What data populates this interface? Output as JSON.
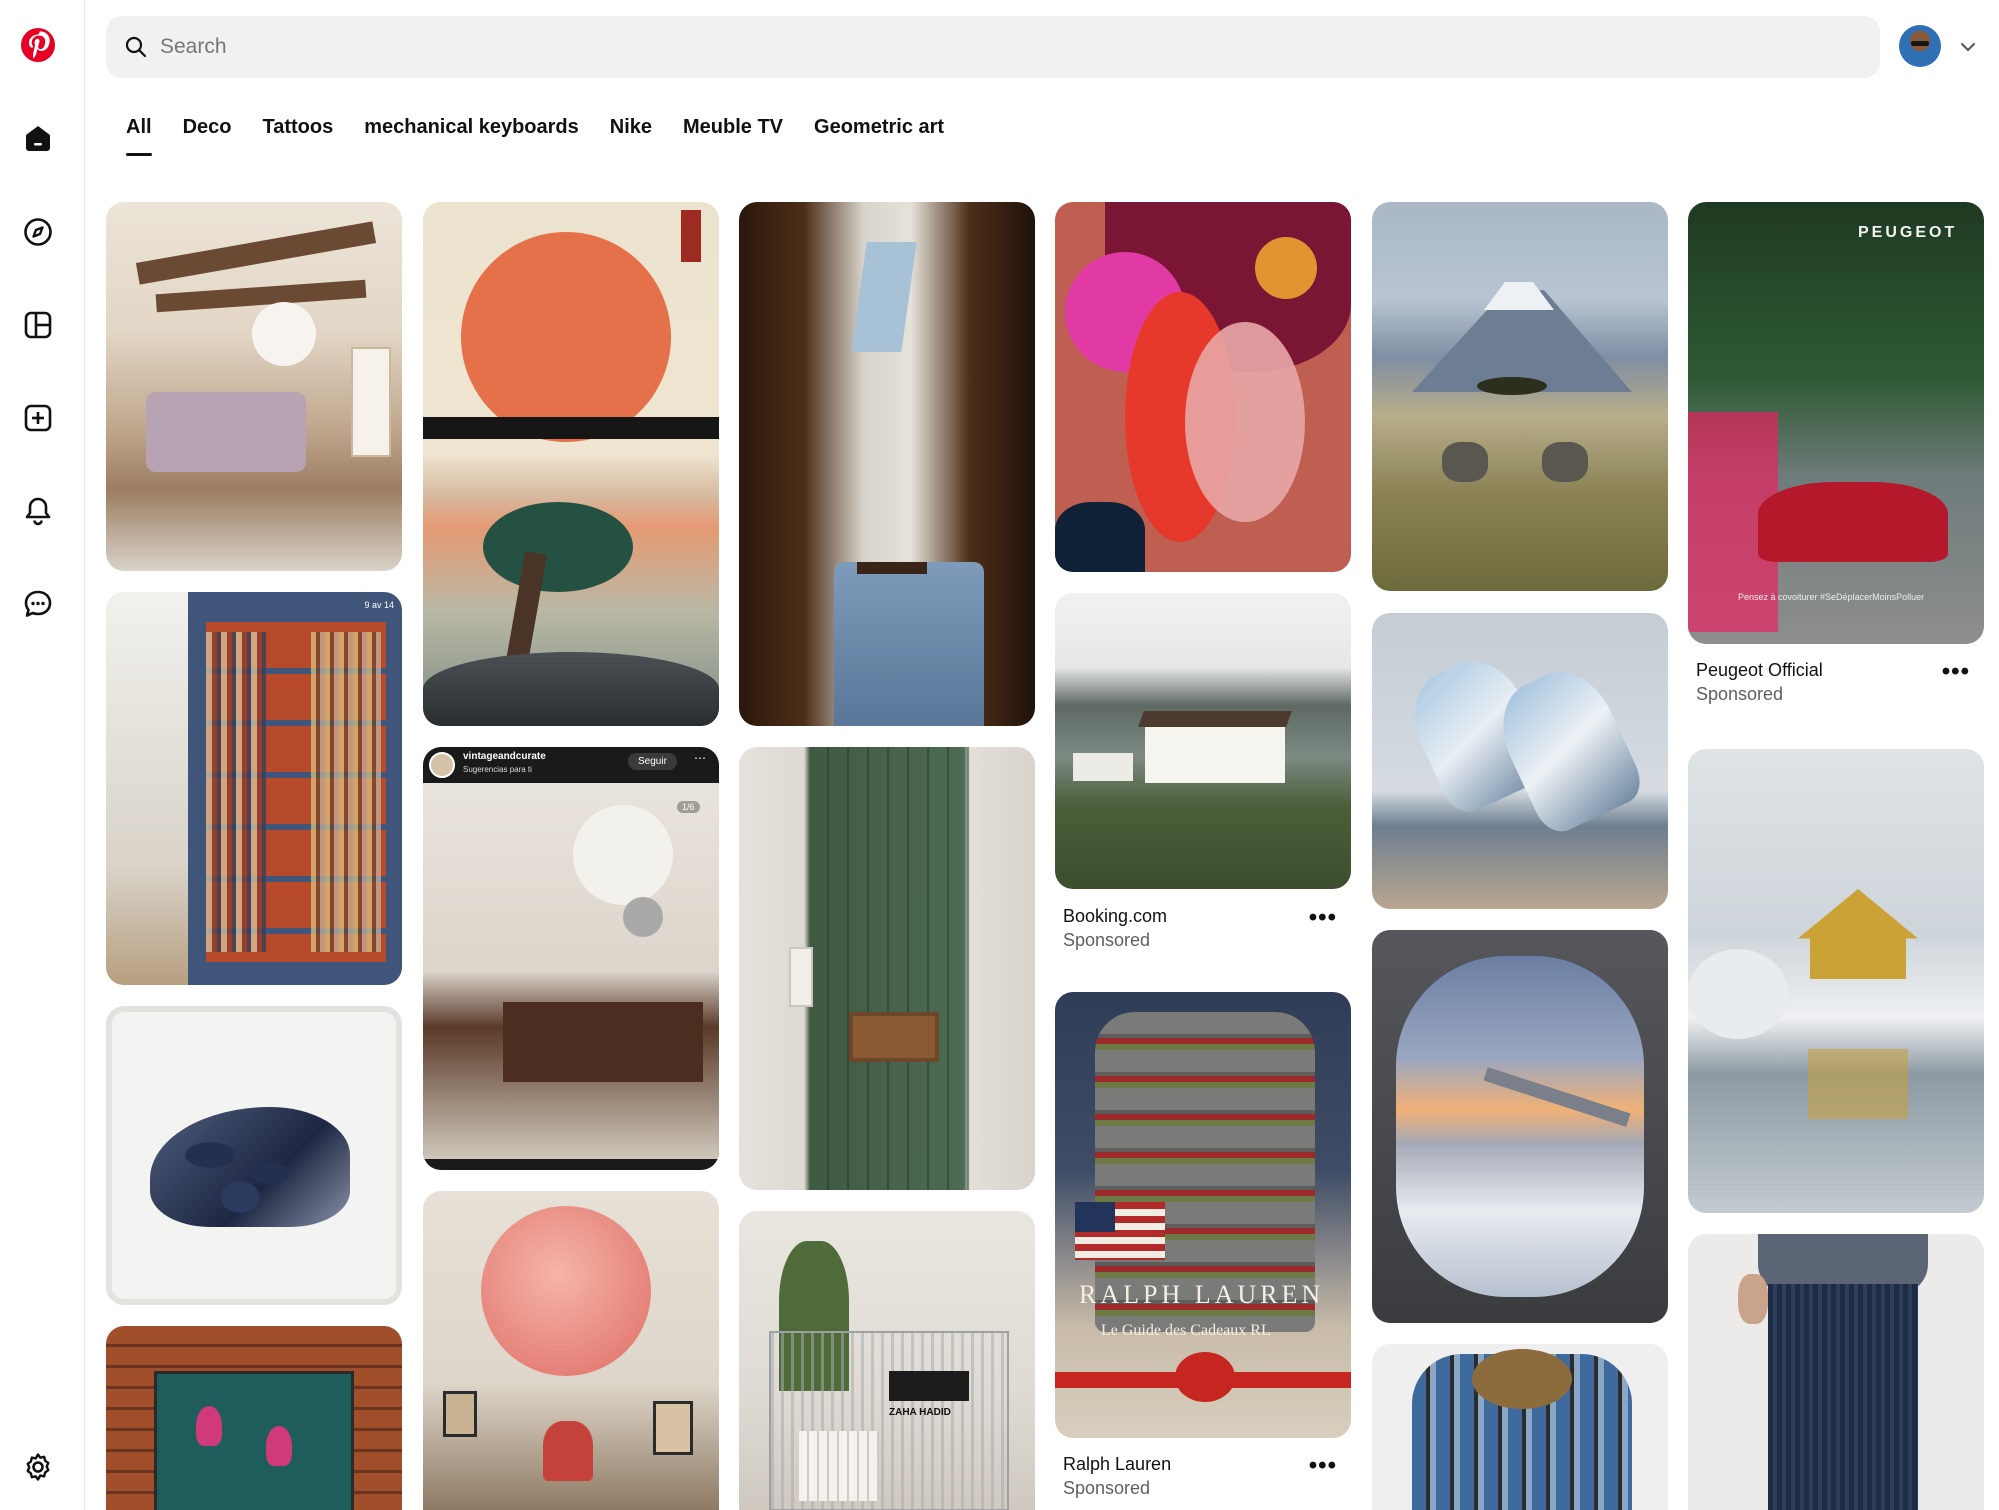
{
  "search": {
    "placeholder": "Search"
  },
  "tabs": [
    "All",
    "Deco",
    "Tattoos",
    "mechanical keyboards",
    "Nike",
    "Meuble TV",
    "Geometric art"
  ],
  "sidebar": {
    "items": [
      "pinterest-logo",
      "home-icon",
      "explore-icon",
      "boards-icon",
      "create-icon",
      "notifications-icon",
      "messages-icon",
      "settings-icon"
    ]
  },
  "pins": {
    "peugeot": {
      "brand_mark": "PEUGEOT",
      "fine_print": "Pensez à covoiturer #SeDéplacerMoinsPolluer",
      "title": "Peugeot Official",
      "subtitle": "Sponsored"
    },
    "booking": {
      "title": "Booking.com",
      "subtitle": "Sponsored"
    },
    "ralph": {
      "headline": "RALPH LAUREN",
      "tagline": "Le Guide des Cadeaux RL",
      "title": "Ralph Lauren",
      "subtitle": "Sponsored"
    },
    "vintage": {
      "account": "vintageandcurate",
      "sub": "Sugerencias para ti",
      "follow": "Seguir",
      "counter": "1/6"
    },
    "bookshelf_tag": "9 av 14",
    "book_label": "ZAHA HADID"
  },
  "more_label": "•••",
  "colors": {
    "accent": "#e60023",
    "text": "#111111",
    "muted": "#5f5f5f",
    "search_bg": "#f1f1f1"
  }
}
